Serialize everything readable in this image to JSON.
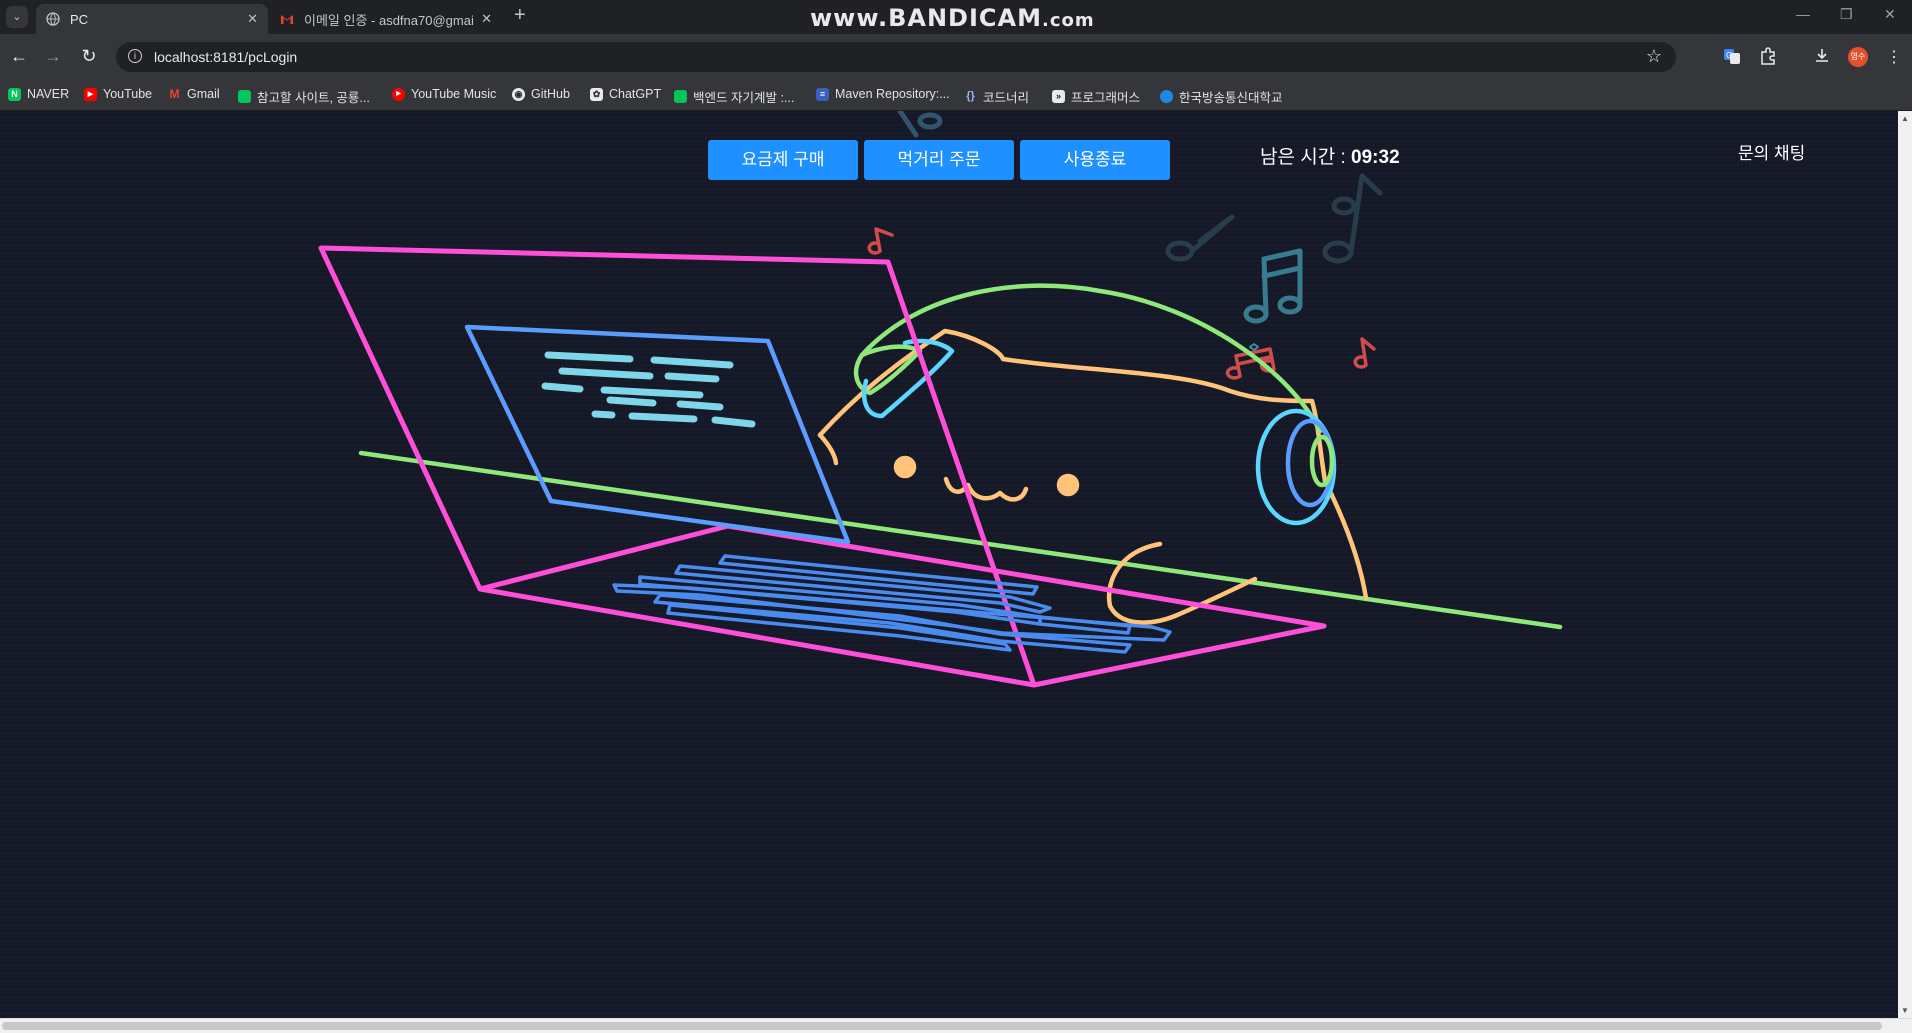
{
  "browser": {
    "tabs": [
      {
        "title": "PC",
        "active": true
      },
      {
        "title": "이메일 인증 - asdfna70@gmai",
        "active": false
      }
    ],
    "new_tab": "+",
    "watermark_main": "www.BANDICAM",
    "watermark_suffix": ".com",
    "url": "localhost:8181/pcLogin",
    "avatar_text": "영수",
    "bookmarks": [
      {
        "label": "NAVER",
        "icon": "naver-icon",
        "color": "#03c75a",
        "glyph": "N"
      },
      {
        "label": "YouTube",
        "icon": "youtube-icon",
        "color": "#ff0000",
        "glyph": "▶"
      },
      {
        "label": "Gmail",
        "icon": "gmail-icon",
        "color": "#ea4335",
        "glyph": "M"
      },
      {
        "label": "참고할 사이트, 공룡...",
        "icon": "folder-icon",
        "color": "#03c75a",
        "glyph": "■"
      },
      {
        "label": "YouTube Music",
        "icon": "youtube-music-icon",
        "color": "#ff0000",
        "glyph": "●"
      },
      {
        "label": "GitHub",
        "icon": "github-icon",
        "color": "#24292f",
        "glyph": "◉"
      },
      {
        "label": "ChatGPT",
        "icon": "chatgpt-icon",
        "color": "#444654",
        "glyph": "✿"
      },
      {
        "label": "백엔드 자기계발 :...",
        "icon": "folder-icon",
        "color": "#03c75a",
        "glyph": "■"
      },
      {
        "label": "Maven Repository:...",
        "icon": "maven-icon",
        "color": "#3b5fc0",
        "glyph": "≡"
      },
      {
        "label": "코드너리",
        "icon": "code-icon",
        "color": "#35363a",
        "glyph": "{}"
      },
      {
        "label": "프로그래머스",
        "icon": "programmers-icon",
        "color": "#0c1530",
        "glyph": "»"
      },
      {
        "label": "한국방송통신대학교",
        "icon": "knou-icon",
        "color": "#1e88e5",
        "glyph": "◍"
      }
    ]
  },
  "page": {
    "buttons": {
      "plan": "요금제 구매",
      "food": "먹거리 주문",
      "end": "사용종료"
    },
    "timer_label": "남은 시간 :",
    "timer_value": "09:32",
    "inquiry": "문의 채팅"
  },
  "colors": {
    "background": "#141827",
    "button": "#1e90ff",
    "laptop": "#ff4fd8",
    "screen": "#5b9cff",
    "cat": "#ffc37a",
    "headphone": "#8ee87a",
    "earcup": "#5bd6ff",
    "note_red": "#e05555",
    "note_teal": "#3e8ea0"
  }
}
